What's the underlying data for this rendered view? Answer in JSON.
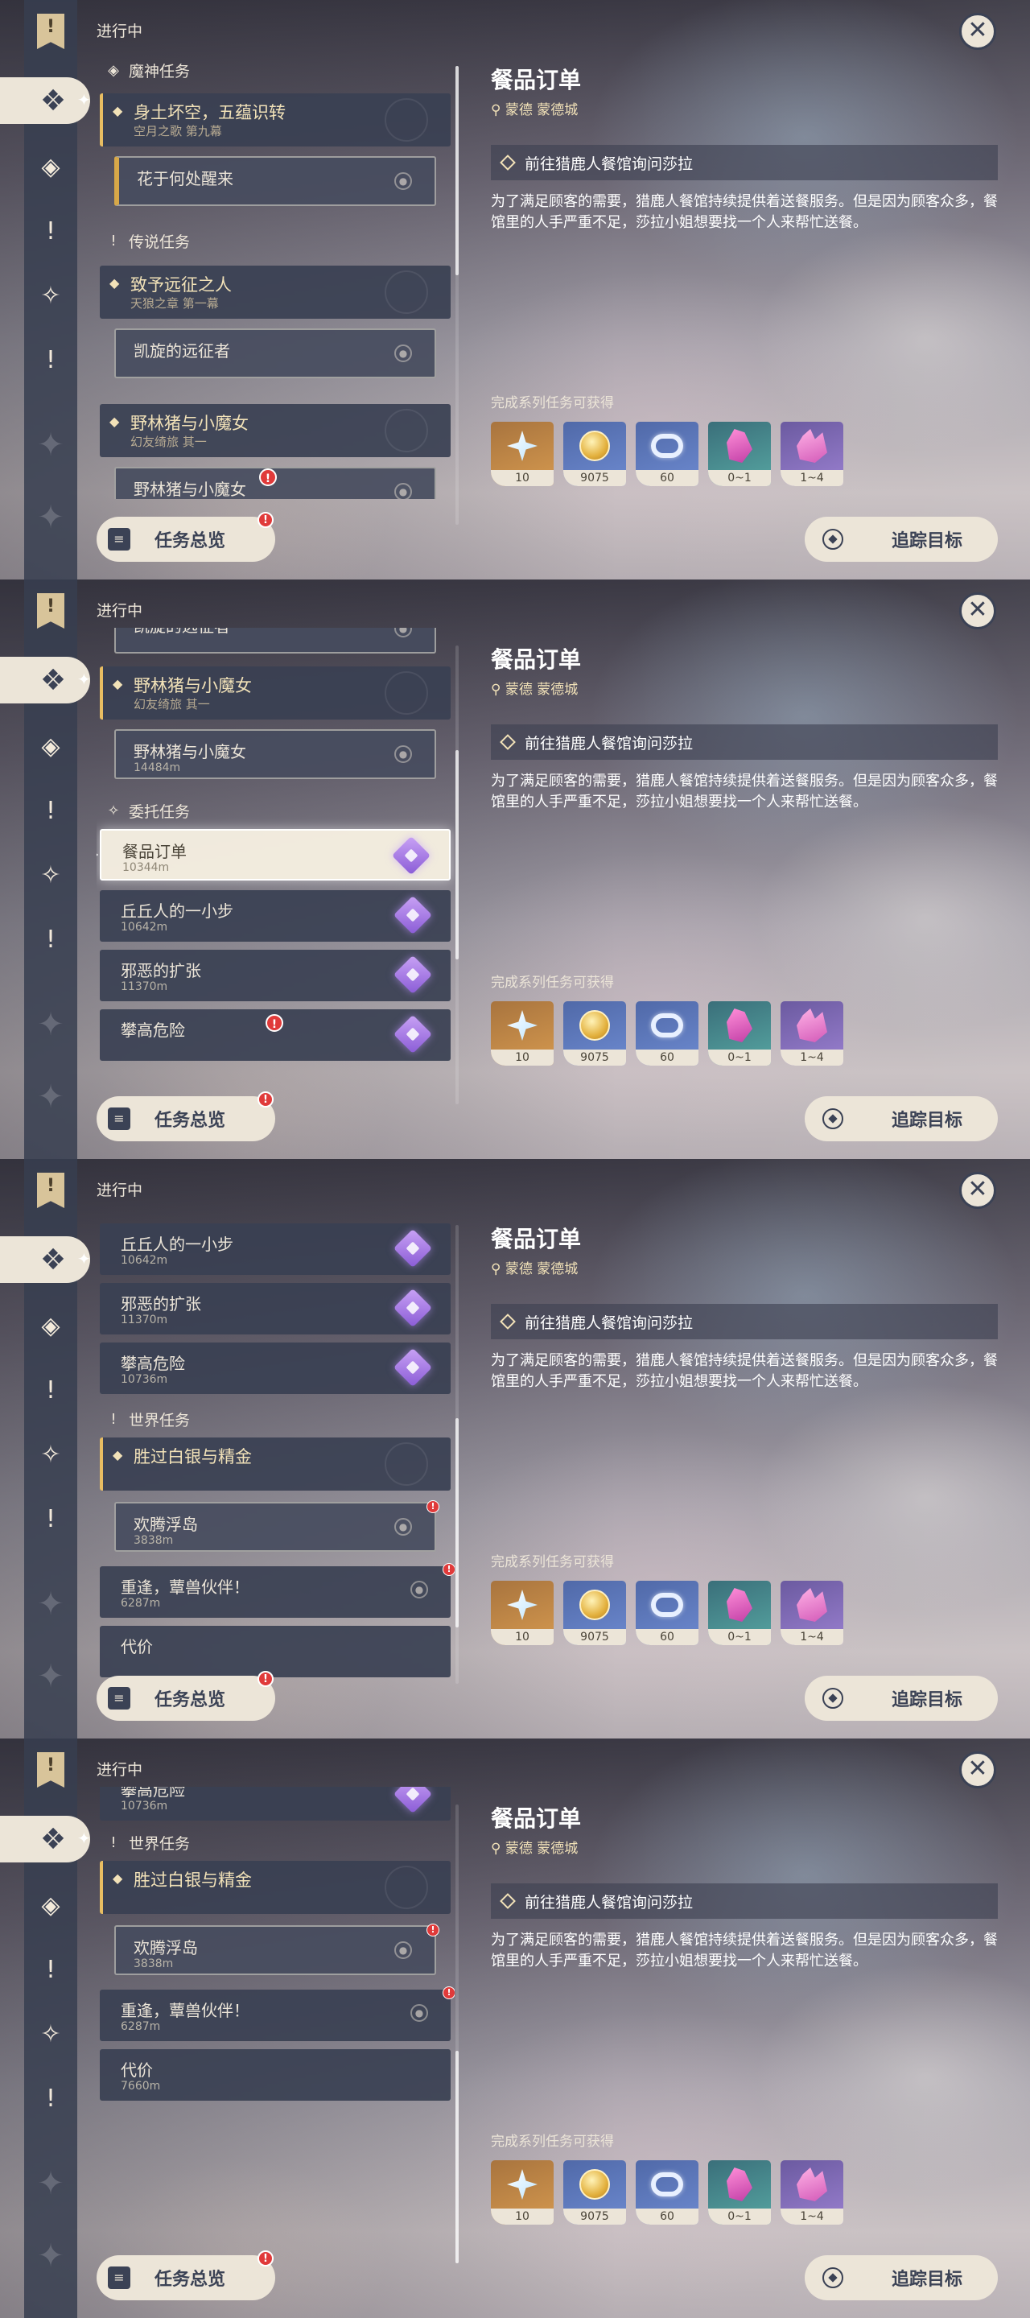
{
  "sidebar": {
    "in_progress": "进行中",
    "overview_label": "任务总览",
    "overview_badge": "!"
  },
  "categories": {
    "archon": "魔神任务",
    "story": "传说任务",
    "commission": "委托任务",
    "world": "世界任务"
  },
  "quests": {
    "archon_group_title": "身土坏空，五蕴识转",
    "archon_group_sub": "空月之歌 第九幕",
    "archon_item": "花于何处醒来",
    "story1_title": "致予远征之人",
    "story1_sub": "天狼之章 第一幕",
    "story1_item": "凯旋的远征者",
    "story2_title": "野林猪与小魔女",
    "story2_sub": "幻友绮旅 其一",
    "story2_item": "野林猪与小魔女",
    "story2_dist": "14484m",
    "c1_name": "餐品订单",
    "c1_dist": "10344m",
    "c2_name": "丘丘人的一小步",
    "c2_dist": "10642m",
    "c3_name": "邪恶的扩张",
    "c3_dist": "11370m",
    "c4_name": "攀高危险",
    "c4_dist": "10736m",
    "world_group_title": "胜过白银与精金",
    "w1_name": "欢腾浮岛",
    "w1_dist": "3838m",
    "w2_name": "重逢，蕈兽伙伴！",
    "w2_dist": "6287m",
    "w3_name": "代价",
    "w3_dist": "7660m",
    "badge": "!"
  },
  "detail": {
    "title": "餐品订单",
    "location": "蒙德 蒙德城",
    "objective": "前往猎鹿人餐馆询问莎拉",
    "description": "为了满足顾客的需要，猎鹿人餐馆持续提供着送餐服务。但是因为顾客众多，餐馆里的人手严重不足，莎拉小姐想要找一个人来帮忙送餐。",
    "rewards_label": "完成系列任务可获得",
    "rewards": [
      {
        "icon": "primogem-icon",
        "qty": "10"
      },
      {
        "icon": "mora-icon",
        "qty": "9075"
      },
      {
        "icon": "exp-book-icon",
        "qty": "60"
      },
      {
        "icon": "crystal-icon",
        "qty": "0~1"
      },
      {
        "icon": "crystal-cluster-icon",
        "qty": "1~4"
      }
    ],
    "track_label": "追踪目标",
    "close_glyph": "✕"
  }
}
